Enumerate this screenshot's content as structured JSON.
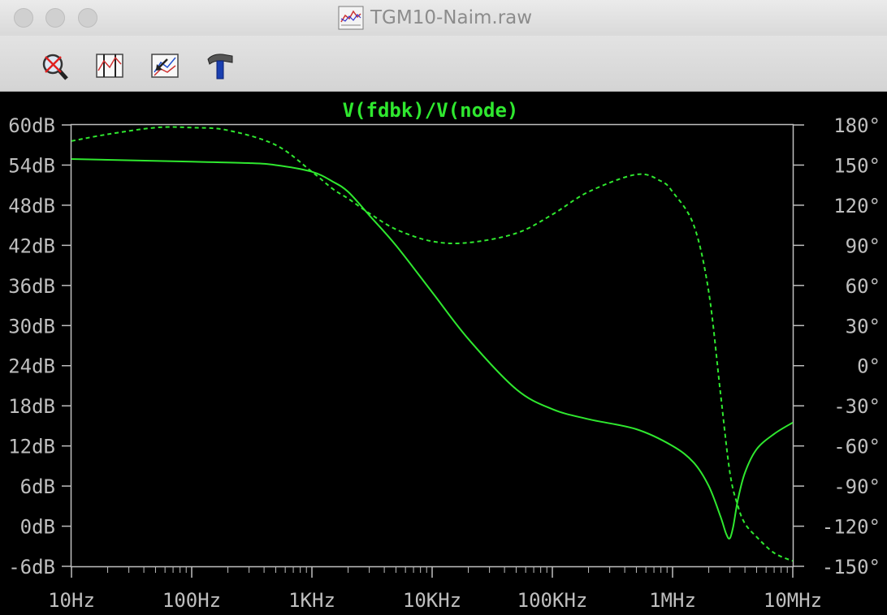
{
  "window": {
    "title": "TGM10-Naim.raw"
  },
  "toolbar": {
    "tools": [
      "zoom-cancel-icon",
      "autorange-icon",
      "undo-zoom-icon",
      "hammer-icon"
    ]
  },
  "chart_data": {
    "type": "line",
    "title": "V(fdbk)/V(node)",
    "xscale": "log",
    "xlim": [
      10,
      10000000
    ],
    "x_ticks": [
      "10Hz",
      "100Hz",
      "1KHz",
      "10KHz",
      "100KHz",
      "1MHz",
      "10MHz"
    ],
    "ylim": [
      -6,
      60
    ],
    "y_ticks": [
      "60dB",
      "54dB",
      "48dB",
      "42dB",
      "36dB",
      "30dB",
      "24dB",
      "18dB",
      "12dB",
      "6dB",
      "0dB",
      "-6dB"
    ],
    "y2lim": [
      -150,
      180
    ],
    "y2_ticks": [
      "180°",
      "150°",
      "120°",
      "90°",
      "60°",
      "30°",
      "0°",
      "-30°",
      "-60°",
      "-90°",
      "-120°",
      "-150°"
    ],
    "color": "#2fe82f",
    "background": "#000000",
    "grid": false,
    "series": [
      {
        "quantity": "magnitude",
        "unit": "dB",
        "axis": "left",
        "style": "solid",
        "x": [
          10,
          100,
          300,
          500,
          1000,
          1500,
          2000,
          3000,
          5000,
          10000,
          20000,
          50000,
          100000,
          200000,
          500000,
          1000000,
          1500000,
          2000000,
          2500000,
          2800000,
          3000000,
          3200000,
          3500000,
          4000000,
          5000000,
          7000000,
          10000000
        ],
        "y": [
          54.9,
          54.5,
          54.3,
          54.0,
          53.0,
          51.5,
          50.0,
          46.5,
          42.0,
          35.0,
          28.0,
          20.5,
          17.5,
          16.0,
          14.5,
          12.0,
          9.5,
          6.0,
          1.5,
          -1.2,
          -1.8,
          0.0,
          4.0,
          8.0,
          11.5,
          13.8,
          15.5
        ]
      },
      {
        "quantity": "phase",
        "unit": "°",
        "axis": "right",
        "style": "dashed",
        "x": [
          10,
          20,
          50,
          100,
          200,
          500,
          1000,
          1500,
          2000,
          3000,
          5000,
          10000,
          20000,
          50000,
          100000,
          200000,
          500000,
          800000,
          1000000,
          1500000,
          2000000,
          2500000,
          3000000,
          3500000,
          4000000,
          5000000,
          7000000,
          10000000
        ],
        "y": [
          168,
          173,
          178,
          178,
          176,
          165,
          145,
          132,
          125,
          114,
          102,
          93,
          92,
          99,
          113,
          130,
          143,
          138,
          130,
          105,
          55,
          -20,
          -80,
          -105,
          -118,
          -128,
          -140,
          -146
        ]
      }
    ]
  }
}
